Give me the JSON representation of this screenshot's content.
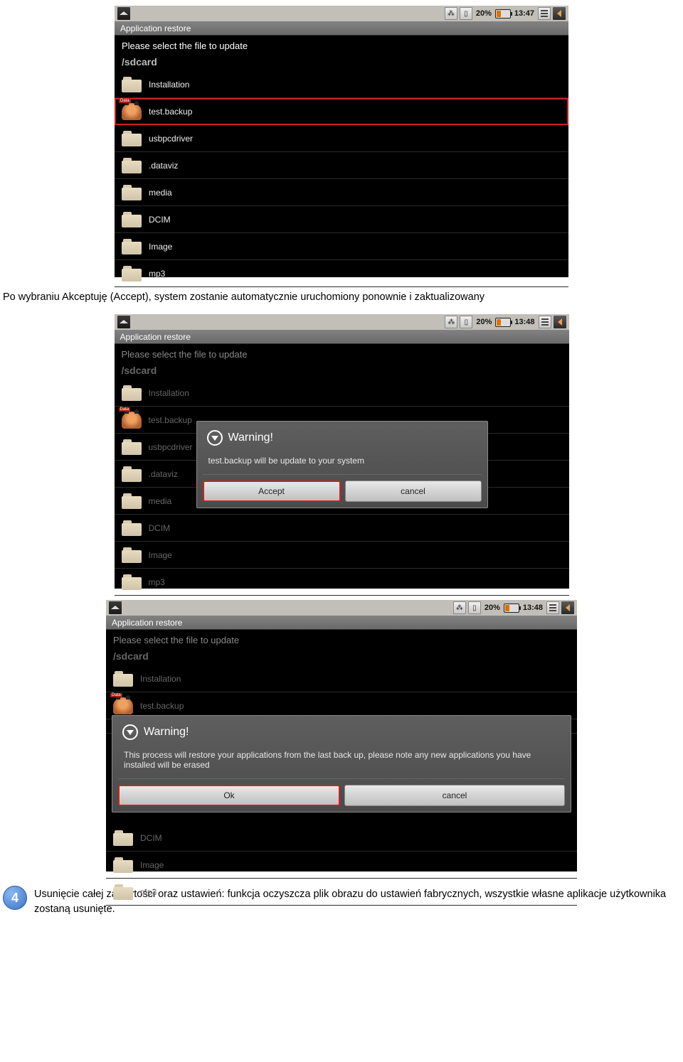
{
  "statusbar": {
    "battery_pct": "20%",
    "time1": "13:47",
    "time2": "13:48",
    "time3": "13:48"
  },
  "app": {
    "title": "Application restore",
    "instruction": "Please select the file to update",
    "path": "/sdcard"
  },
  "files": [
    {
      "name": "Installation",
      "type": "folder"
    },
    {
      "name": "test.backup",
      "type": "backup",
      "selected": true
    },
    {
      "name": "usbpcdriver",
      "type": "folder"
    },
    {
      "name": ".dataviz",
      "type": "folder"
    },
    {
      "name": "media",
      "type": "folder"
    },
    {
      "name": "DCIM",
      "type": "folder"
    },
    {
      "name": "Image",
      "type": "folder"
    },
    {
      "name": "mp3",
      "type": "folder"
    }
  ],
  "dialog1": {
    "title": "Warning!",
    "body": "test.backup will be update to your system",
    "accept": "Accept",
    "cancel": "cancel"
  },
  "dialog2": {
    "title": "Warning!",
    "body": "This process will restore your applications from the last back up, please note any new applications you have installed will be erased",
    "ok": "Ok",
    "cancel": "cancel"
  },
  "captions": {
    "after_ss1": "Po wybraniu Akceptuję (Accept), system zostanie automatycznie uruchomiony ponownie i zaktualizowany",
    "step4_num": "4",
    "step4_text": "Usunięcie całej zawartości oraz ustawień: funkcja oczyszcza plik obrazu do ustawień fabrycznych, wszystkie własne aplikacje użytkownika zostaną usunięte."
  }
}
